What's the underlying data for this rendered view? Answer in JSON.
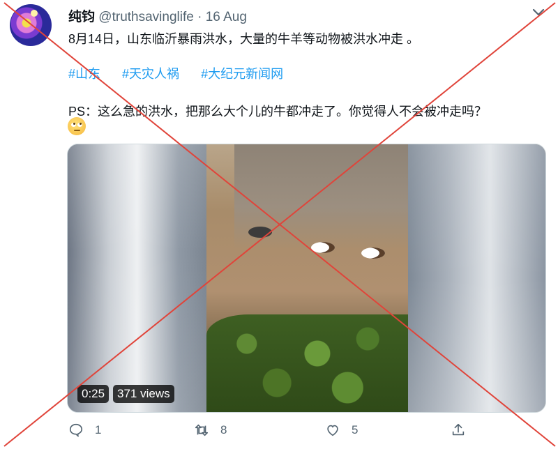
{
  "tweet": {
    "author_name": "纯钧",
    "handle": "@truthsavinglife",
    "separator": "·",
    "date": "16 Aug",
    "text_line1": "8月14日，山东临沂暴雨洪水，大量的牛羊等动物被洪水冲走 。",
    "hashtags": [
      "#山东",
      "#天灾人祸",
      "#大纪元新闻网"
    ],
    "text_line3": "PS：这么急的洪水，把那么大个儿的牛都冲走了。你觉得人不会被冲走吗？",
    "emoji": "rolling-eyes-emoji"
  },
  "video": {
    "duration": "0:25",
    "views": "371 views"
  },
  "actions": {
    "reply_count": "1",
    "retweet_count": "8",
    "like_count": "5"
  },
  "colors": {
    "link": "#1d9bf0",
    "muted": "#536471",
    "overlay_x": "#e0443a"
  }
}
